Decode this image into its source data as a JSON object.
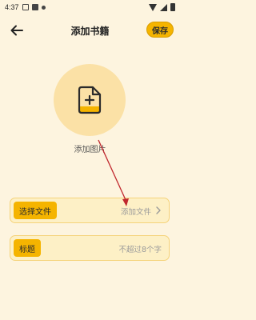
{
  "status_bar": {
    "time": "4:37"
  },
  "header": {
    "title": "添加书籍",
    "save_label": "保存"
  },
  "cover": {
    "label": "添加图片"
  },
  "file_row": {
    "tag": "选择文件",
    "value": "添加文件"
  },
  "title_row": {
    "tag": "标题",
    "placeholder": "不超过8个字"
  },
  "colors": {
    "background": "#fdf4df",
    "accent": "#f5b400",
    "circle": "#fbe1a6",
    "annotation_arrow": "#c0272d"
  },
  "icons": {
    "back": "arrow-left-icon",
    "cover": "file-add-icon",
    "chevron": "chevron-right-icon"
  }
}
